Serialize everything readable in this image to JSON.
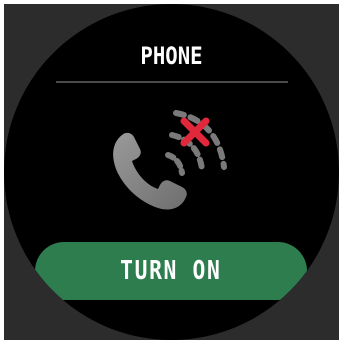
{
  "screen": {
    "title": "PHONE"
  },
  "status_icon": {
    "name": "phone-disabled-icon",
    "handset_color": "#8a8a8a",
    "waves_color": "#7a7a7a",
    "cross_color": "#e0283a"
  },
  "action": {
    "label": "TURN ON",
    "color": "#2e7d4f"
  }
}
